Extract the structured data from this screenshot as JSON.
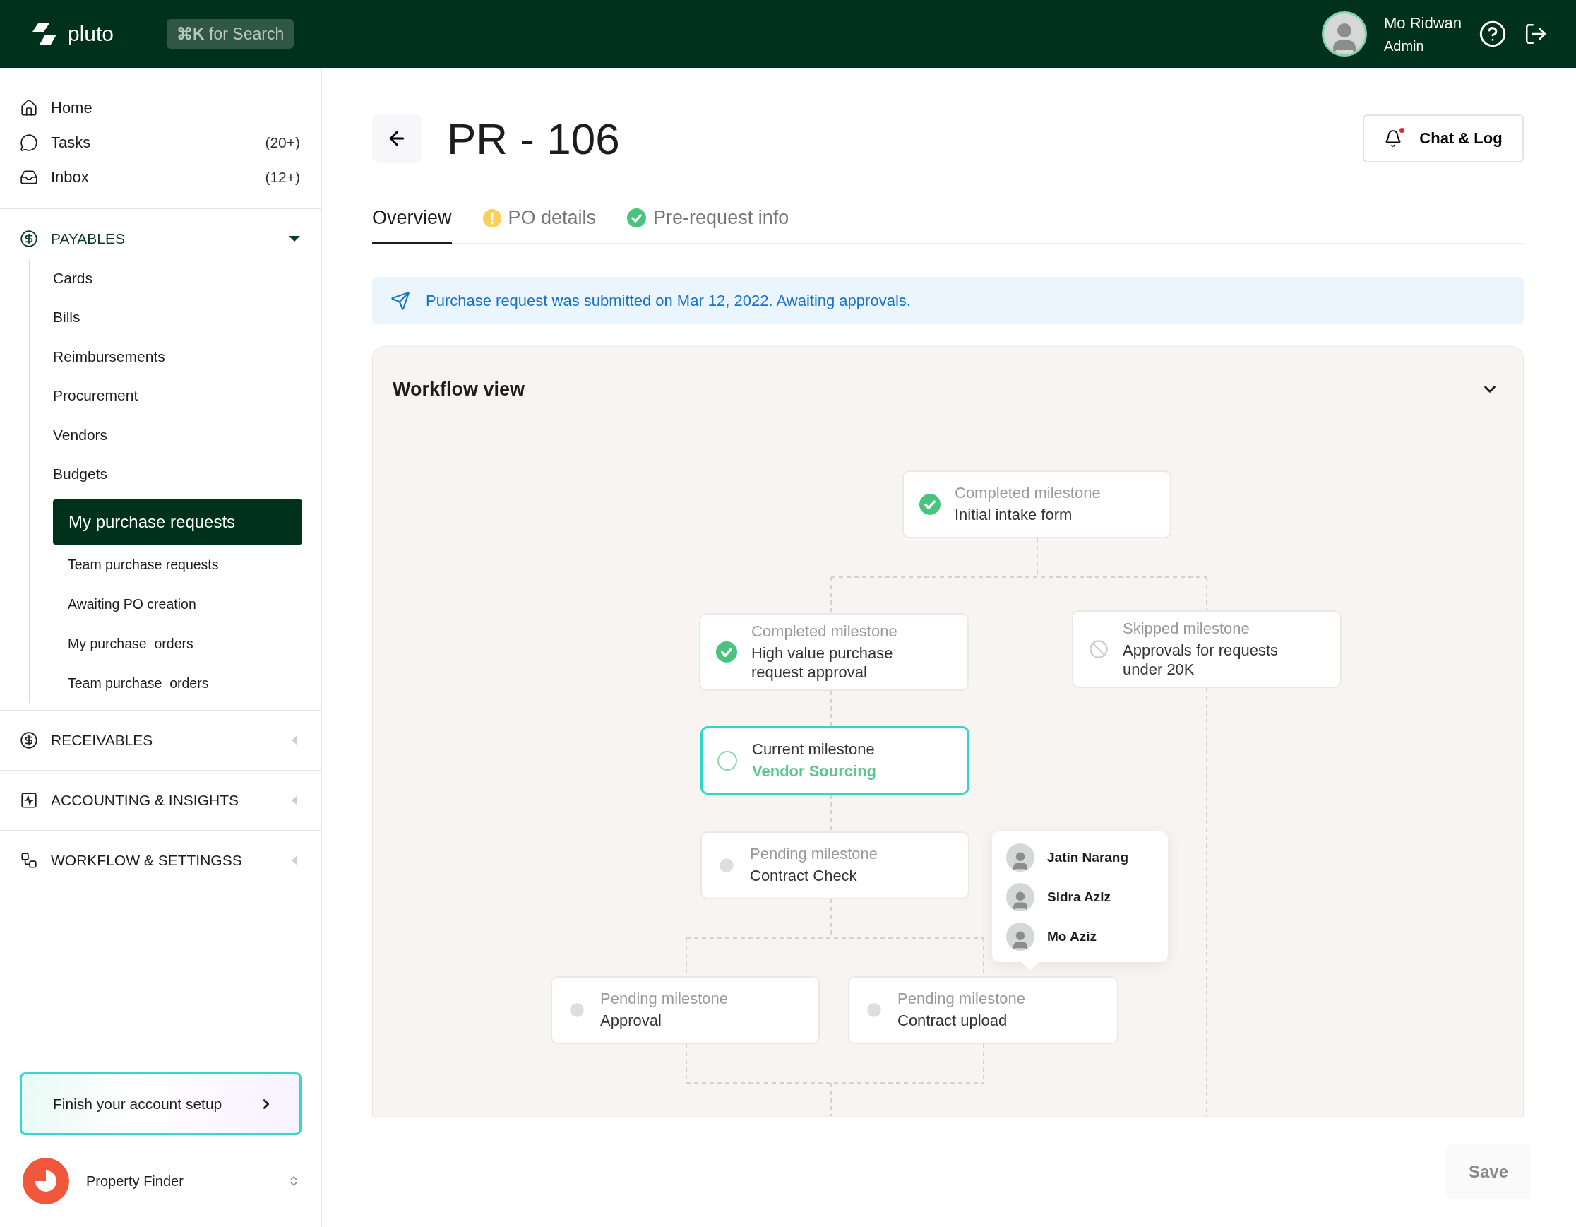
{
  "topbar": {
    "logo": "pluto",
    "search_hint": "**⌘K** for Search",
    "user": {
      "name": "Mo Ridwan",
      "role": "Admin"
    }
  },
  "sidebar": {
    "nav": [
      {
        "kind": "home",
        "label": "Home"
      },
      {
        "kind": "tasks",
        "label": "Tasks",
        "count": "(20+)"
      },
      {
        "kind": "inbox",
        "label": "Inbox",
        "count": "(12+)"
      }
    ],
    "sections": [
      {
        "kind": "payables",
        "label": "PAYABLES",
        "expanded": true,
        "items": [
          {
            "label": "Cards",
            "selected": false
          },
          {
            "label": "Bills",
            "selected": false
          },
          {
            "label": "Reimbursements",
            "selected": false
          },
          {
            "label": "Procurement",
            "selected": false
          },
          {
            "label": "Vendors",
            "selected": false
          },
          {
            "label": "Budgets",
            "selected": false
          },
          {
            "label": "My purchase requests",
            "selected": true,
            "children": [
              {
                "label": "Team purchase requests",
                "selected": false
              },
              {
                "label": "Awaiting PO creation",
                "selected": false
              },
              {
                "label": "My purchase  orders",
                "selected": false
              },
              {
                "label": "Team purchase  orders",
                "selected": false
              }
            ]
          }
        ]
      },
      {
        "kind": "receivables",
        "label": "RECEIVABLES",
        "expanded": false
      },
      {
        "kind": "accounting",
        "label": "ACCOUNTING & INSIGHTS",
        "expanded": false
      },
      {
        "kind": "workflow",
        "label": "WORKFLOW & SETTINGSS",
        "expanded": false
      }
    ],
    "setup": "Finish your account setup",
    "org": "Property Finder"
  },
  "header": {
    "title": "PR - 106",
    "chat_button": "Chat & Log",
    "notification": true
  },
  "tabs": [
    {
      "label": "Overview",
      "selected": true,
      "kind": "plain"
    },
    {
      "label": "PO details",
      "selected": false,
      "kind": "warning"
    },
    {
      "label": "Pre-request info",
      "selected": false,
      "kind": "done"
    }
  ],
  "banner": "Purchase request was submitted on Mar 12, 2022. Awaiting approvals.",
  "workflow": {
    "title": "Workflow view",
    "expanded": true,
    "milestones": [
      {
        "kind": "completed",
        "caption": "Completed milestone",
        "name": "Initial intake form"
      },
      {
        "kind": "completed",
        "caption": "Completed milestone",
        "name": "High value purchase request approval"
      },
      {
        "kind": "skipped",
        "caption": "Skipped milestone",
        "name": "Approvals for requests under 20K"
      },
      {
        "kind": "current",
        "caption": "Current milestone",
        "name": "Vendor Sourcing"
      },
      {
        "kind": "pending",
        "caption": "Pending milestone",
        "name": "Contract Check"
      },
      {
        "kind": "pending",
        "caption": "Pending milestone",
        "name": "Approval"
      },
      {
        "kind": "pending",
        "caption": "Pending milestone",
        "name": "Contract upload"
      }
    ],
    "approvers": [
      "Jatin Narang",
      "Sidra Aziz",
      "Mo Aziz"
    ]
  },
  "footer": {
    "save": "Save",
    "disabled": true
  }
}
